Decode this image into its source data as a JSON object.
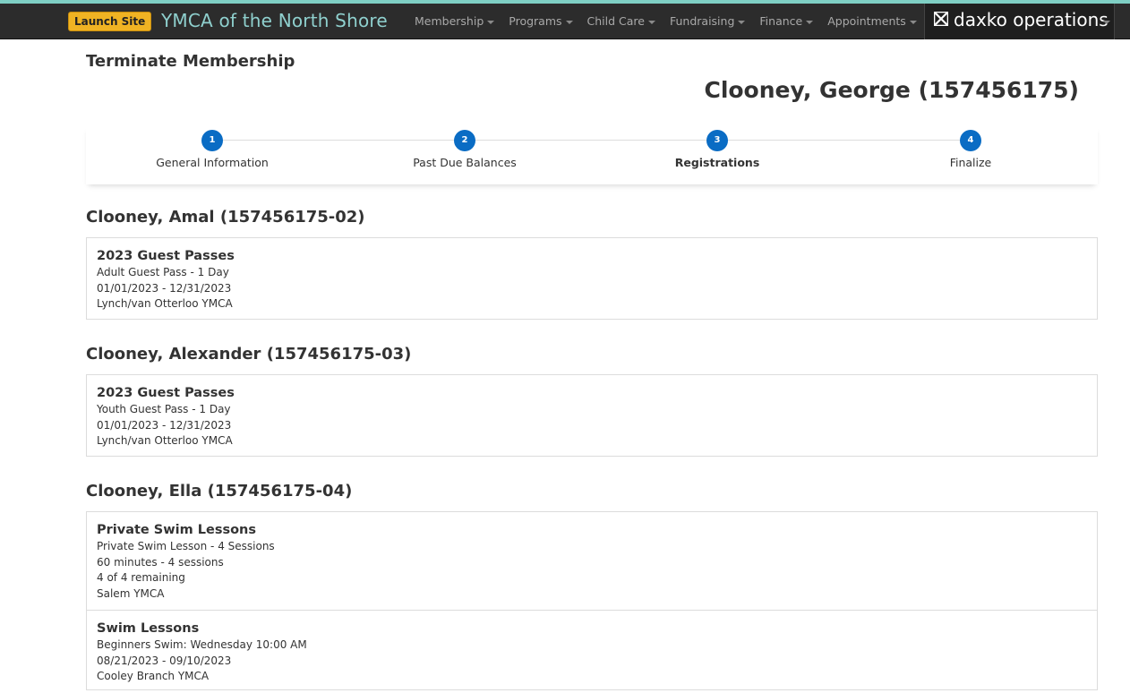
{
  "topbar": {
    "launch_label": "Launch Site",
    "brand": "YMCA of the North Shore",
    "nav": [
      "Membership",
      "Programs",
      "Child Care",
      "Fundraising",
      "Finance",
      "Appointments"
    ],
    "product": "daxko operations"
  },
  "page": {
    "title": "Terminate Membership",
    "member": "Clooney, George (157456175)"
  },
  "steps": [
    {
      "num": "1",
      "label": "General Information"
    },
    {
      "num": "2",
      "label": "Past Due Balances"
    },
    {
      "num": "3",
      "label": "Registrations"
    },
    {
      "num": "4",
      "label": "Finalize"
    }
  ],
  "people": [
    {
      "name": "Clooney, Amal (157456175-02)",
      "registrations": [
        {
          "title": "2023 Guest Passes",
          "lines": [
            "Adult Guest Pass - 1 Day",
            "01/01/2023 - 12/31/2023",
            "Lynch/van Otterloo YMCA"
          ]
        }
      ]
    },
    {
      "name": "Clooney, Alexander (157456175-03)",
      "registrations": [
        {
          "title": "2023 Guest Passes",
          "lines": [
            "Youth Guest Pass - 1 Day",
            "01/01/2023 - 12/31/2023",
            "Lynch/van Otterloo YMCA"
          ]
        }
      ]
    },
    {
      "name": "Clooney, Ella (157456175-04)",
      "registrations": [
        {
          "title": "Private Swim Lessons",
          "lines": [
            "Private Swim Lesson - 4 Sessions",
            "60 minutes - 4 sessions",
            "4 of 4 remaining",
            "Salem YMCA"
          ]
        },
        {
          "title": "Swim Lessons",
          "lines": [
            "Beginners Swim: Wednesday 10:00 AM",
            "08/21/2023 - 09/10/2023",
            "Cooley Branch YMCA"
          ]
        }
      ]
    }
  ]
}
